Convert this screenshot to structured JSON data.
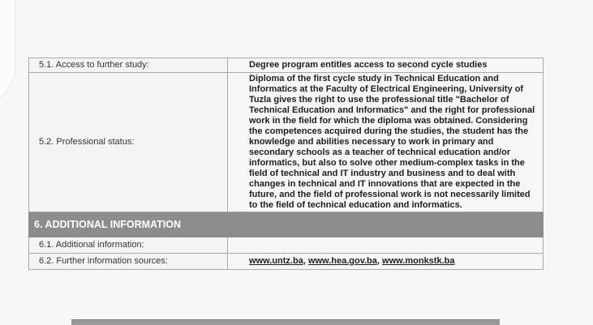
{
  "rows": {
    "access_label": "5.1. Access to further study:",
    "access_value": "Degree program entitles access to second cycle studies",
    "status_label": "5.2. Professional status:",
    "status_value": "Diploma of the first cycle study in Technical Education and Informatics at the Faculty of Electrical Engineering, University of Tuzla gives the right to use the professional title \"Bachelor of Technical Education and Informatics\" and the right for professional work in the field for which the diploma was obtained. Considering the competences acquired during the studies, the student has the knowledge and abilities necessary to work in primary and secondary schools as a teacher of technical education and/or informatics, but also to solve other medium-complex tasks in the field of technical and IT industry and business and to deal with changes in technical and IT innovations that are expected in the future, and the field of professional work is not necessarily limited to the field of technical education and informatics."
  },
  "section": {
    "title": "6. ADDITIONAL INFORMATION"
  },
  "additional": {
    "info_label": "6.1. Additional information:",
    "info_value": "",
    "sources_label": "6.2. Further information sources:",
    "sources_links": [
      "www.untz.ba",
      "www.hea.gov.ba",
      "www.monkstk.ba"
    ],
    "sources_separator": ", "
  }
}
